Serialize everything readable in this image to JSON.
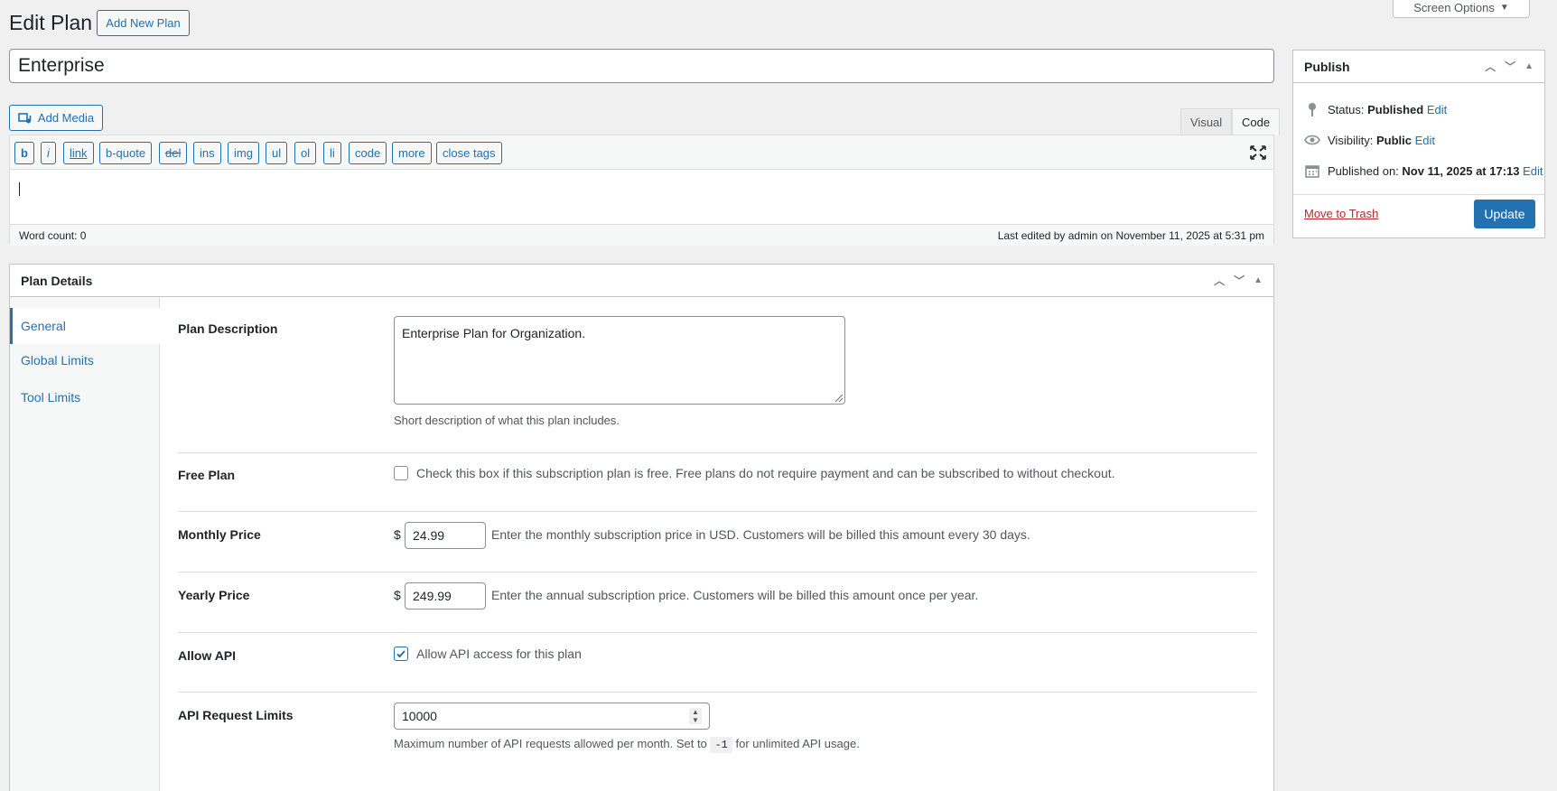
{
  "header": {
    "title": "Edit Plan",
    "add_new_label": "Add New Plan",
    "screen_options_label": "Screen Options"
  },
  "post_title": "Enterprise",
  "editor": {
    "add_media_label": "Add Media",
    "tabs": [
      "Visual",
      "Code"
    ],
    "active_tab": "Code",
    "quicktags": [
      "b",
      "i",
      "link",
      "b-quote",
      "del",
      "ins",
      "img",
      "ul",
      "ol",
      "li",
      "code",
      "more",
      "close tags"
    ],
    "word_count": "Word count: 0",
    "last_edited": "Last edited by admin on November 11, 2025 at 5:31 pm"
  },
  "publish": {
    "title": "Publish",
    "status_label": "Status:",
    "status_value": "Published",
    "visibility_label": "Visibility:",
    "visibility_value": "Public",
    "published_label": "Published on:",
    "published_value": "Nov 11, 2025 at 17:13",
    "edit_label": "Edit",
    "trash_label": "Move to Trash",
    "update_label": "Update"
  },
  "plan_details": {
    "title": "Plan Details",
    "nav": [
      "General",
      "Global Limits",
      "Tool Limits"
    ],
    "active_nav": "General",
    "fields": {
      "description": {
        "label": "Plan Description",
        "value": "Enterprise Plan for Organization.",
        "help": "Short description of what this plan includes."
      },
      "free_plan": {
        "label": "Free Plan",
        "checked": false,
        "text": "Check this box if this subscription plan is free. Free plans do not require payment and can be subscribed to without checkout."
      },
      "monthly_price": {
        "label": "Monthly Price",
        "currency": "$",
        "value": "24.99",
        "help": "Enter the monthly subscription price in USD. Customers will be billed this amount every 30 days."
      },
      "yearly_price": {
        "label": "Yearly Price",
        "currency": "$",
        "value": "249.99",
        "help": "Enter the annual subscription price. Customers will be billed this amount once per year."
      },
      "allow_api": {
        "label": "Allow API",
        "checked": true,
        "text": "Allow API access for this plan"
      },
      "api_limits": {
        "label": "API Request Limits",
        "value": "10000",
        "help_before": "Maximum number of API requests allowed per month. Set to",
        "help_code": "-1",
        "help_after": "for unlimited API usage."
      }
    }
  },
  "colors": {
    "accent": "#2271b1",
    "danger": "#b32d2e",
    "background": "#f0f0f1"
  }
}
